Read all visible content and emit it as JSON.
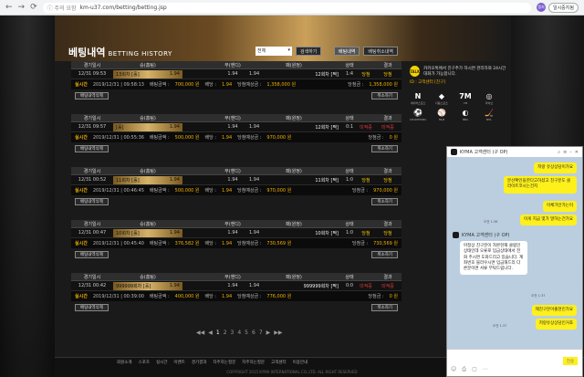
{
  "browser": {
    "back": "←",
    "forward": "→",
    "reload": "⟳",
    "security": "ⓘ 주의 요함",
    "url": "km-u37.com/betting/betting.jsp",
    "avatar": "캡처",
    "paused": "일시중지됨"
  },
  "header": {
    "title": "베팅내역",
    "subtitle": "BETTING HISTORY",
    "select_value": "전체",
    "search_label": "검색하기",
    "tabs": [
      "배팅내역",
      "배팅취소내역"
    ]
  },
  "columns": [
    "경기일시",
    "승(홈팀)",
    "무(핸디)",
    "패(원정)",
    "상태",
    "결과"
  ],
  "bets": [
    {
      "date": "12/31",
      "time": "09:53",
      "home": "13회차 [홀]",
      "home_odd": "1.94",
      "draw": "1.94",
      "away": "1.94",
      "away_team": "12회차 [짝]",
      "status_a": "1:4",
      "status_b": "당첨",
      "live": "실시간",
      "bet_time": "2019/12/31 | 09:58:13",
      "bet_amount_label": "배팅금액 :",
      "bet_amount": "700,000 원",
      "rate_label": "배당 :",
      "rate": "1.94",
      "win_label": "당첨예상금 :",
      "win": "1,358,000 원",
      "won_label": "당첨금 :",
      "won": "1,358,000 원",
      "delete_label": "배팅내역삭제",
      "cancel_label": "취소하기",
      "result": "당첨"
    },
    {
      "date": "12/31",
      "time": "09:57",
      "home": "[홀]",
      "home_odd": "1.94",
      "draw": "1.94",
      "away": "1.94",
      "away_team": "12회차 [짝]",
      "status_a": "0:1",
      "status_b": "미적중",
      "live": "실시간",
      "bet_time": "2019/12/31 | 00:55:36",
      "bet_amount_label": "배팅금액 :",
      "bet_amount": "500,000 원",
      "rate_label": "배당 :",
      "rate": "1.94",
      "win_label": "당첨예상금 :",
      "win": "970,000 원",
      "won_label": "당첨금 :",
      "won": "0 원",
      "delete_label": "배팅내역삭제",
      "cancel_label": "취소하기",
      "result": "미적중"
    },
    {
      "date": "12/31",
      "time": "00:52",
      "home": "11회차 [홀]",
      "home_odd": "1.94",
      "draw": "1.94",
      "away": "1.94",
      "away_team": "11회차 [짝]",
      "status_a": "1:0",
      "status_b": "당첨",
      "live": "실시간",
      "bet_time": "2019/12/31 | 00:46:45",
      "bet_amount_label": "배팅금액 :",
      "bet_amount": "500,000 원",
      "rate_label": "배당 :",
      "rate": "1.94",
      "win_label": "당첨예상금 :",
      "win": "970,000 원",
      "won_label": "당첨금 :",
      "won": "970,000 원",
      "delete_label": "배팅내역삭제",
      "cancel_label": "취소하기",
      "result": "당첨"
    },
    {
      "date": "12/31",
      "time": "00:47",
      "home": "10회차 [홀]",
      "home_odd": "1.94",
      "draw": "1.94",
      "away": "1.94",
      "away_team": "10회차 [짝]",
      "status_a": "1:0",
      "status_b": "당첨",
      "live": "실시간",
      "bet_time": "2019/12/31 | 00:45:40",
      "bet_amount_label": "배팅금액 :",
      "bet_amount": "376,582 원",
      "rate_label": "배당 :",
      "rate": "1.94",
      "win_label": "당첨예상금 :",
      "win": "730,569 원",
      "won_label": "당첨금 :",
      "won": "730,569 원",
      "delete_label": "배팅내역삭제",
      "cancel_label": "취소하기",
      "result": "당첨"
    },
    {
      "date": "12/31",
      "time": "00:42",
      "home": "999999회차 [홀]",
      "home_odd": "1.94",
      "draw": "1.94",
      "away": "1.94",
      "away_team": "999999회차 [짝]",
      "status_a": "0:0",
      "status_b": "미적중",
      "live": "실시간",
      "bet_time": "2019/12/31 | 00:39:00",
      "bet_amount_label": "배팅금액 :",
      "bet_amount": "400,000 원",
      "rate_label": "배당 :",
      "rate": "1.94",
      "win_label": "당첨예상금 :",
      "win": "776,000 원",
      "won_label": "당첨금 :",
      "won": "0 원",
      "delete_label": "배팅내역삭제",
      "cancel_label": "취소하기",
      "result": "미적중"
    }
  ],
  "pagination": [
    "◀◀",
    "◀",
    "1",
    "2",
    "3",
    "4",
    "5",
    "6",
    "7",
    "▶",
    "▶▶"
  ],
  "footer": {
    "nav": [
      "회원소개",
      "스포츠",
      "실시간",
      "이벤트",
      "경기결과",
      "자주하는질문",
      "자주하는질문",
      "고객센터",
      "이용안내"
    ],
    "copyright": "COPYRIGHT 2015 KYMA INTERNATIONAL CO.,LTD. ALL RIGHT RESERVED"
  },
  "sidebar": {
    "talk_label": "TALK",
    "talk_text": "카카오톡에서 친구추가 하시면 관리자와 24시간 대화가 가능합니다.",
    "cs": "ID : 고객센터 [친구]",
    "logos": [
      {
        "mark": "N",
        "label": "네이버스포츠"
      },
      {
        "mark": "◆",
        "label": "다음스포츠"
      },
      {
        "mark": "7M",
        "label": "7M"
      },
      {
        "mark": "◎",
        "label": "라이브"
      },
      {
        "mark": "⚽",
        "label": "CHAMPIONS"
      },
      {
        "mark": "⚾",
        "label": "MLB"
      },
      {
        "mark": "◐",
        "label": "NBA"
      },
      {
        "mark": "🏒",
        "label": "NHL"
      }
    ]
  },
  "chat": {
    "title": "KYMA 고객센터 (구 OP)",
    "messages": [
      {
        "who": "me",
        "text": "저랑 유상상담이가요"
      },
      {
        "who": "me",
        "text": "분산확인을한다고하셨고 친구분도 클라이트코시는건지"
      },
      {
        "who": "me",
        "text": "이체가안가는이"
      },
      {
        "who": "me",
        "text": "이게 지금 몇가 말하는건가요"
      },
      {
        "who": "them",
        "name": "KYMA 고객센터 (구 OP)",
        "text": "아정상 친구분이 자본현재 클럽인 상태인데 오류로 입금상태에서 전화 주시면 도와드리고 있습니다. 계좌번호 블라우시면 입금해드리 다른분이면 서류 부탁드립니다."
      },
      {
        "who": "me",
        "text": "제친구분이출현인가요"
      },
      {
        "who": "me",
        "text": "저랑유상상담인거죠"
      }
    ],
    "times": [
      "오전 1:36",
      "오전 1:37",
      "오전 1:37"
    ],
    "send": "전송"
  }
}
